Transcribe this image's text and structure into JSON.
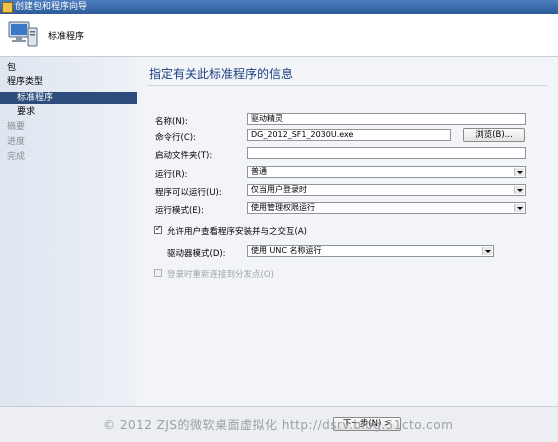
{
  "window": {
    "title": "创建包和程序向导"
  },
  "header": {
    "title": "标准程序"
  },
  "sidebar": {
    "items": [
      {
        "label": "包"
      },
      {
        "label": "程序类型"
      },
      {
        "label": "标准程序"
      },
      {
        "label": "要求"
      },
      {
        "label": "摘要"
      },
      {
        "label": "进度"
      },
      {
        "label": "完成"
      }
    ]
  },
  "main": {
    "heading": "指定有关此标准程序的信息",
    "name": {
      "label": "名称(N):",
      "value": "驱动精灵"
    },
    "command_line": {
      "label": "命令行(C):",
      "value": "DG_2012_SF1_2030U.exe",
      "browse_label": "浏览(B)..."
    },
    "start_folder": {
      "label": "启动文件夹(T):",
      "value": ""
    },
    "run": {
      "label": "运行(R):",
      "value": "普通"
    },
    "program_can_run": {
      "label": "程序可以运行(U):",
      "value": "仅当用户登录时"
    },
    "run_mode": {
      "label": "运行模式(E):",
      "value": "使用管理权限运行"
    },
    "allow_interact": {
      "label": "允许用户查看程序安装并与之交互(A)",
      "checked": true
    },
    "drive_mode": {
      "label": "驱动器模式(D):",
      "value": "使用 UNC 名称运行"
    },
    "reconnect": {
      "label": "登录时重新连接到分发点(O)",
      "checked": false,
      "disabled": true
    }
  },
  "footer": {
    "next_label": "下一步(N) >",
    "watermark": "© 2012 ZJS的微软桌面虚拟化 http://dsrv.blog.51cto.com"
  }
}
